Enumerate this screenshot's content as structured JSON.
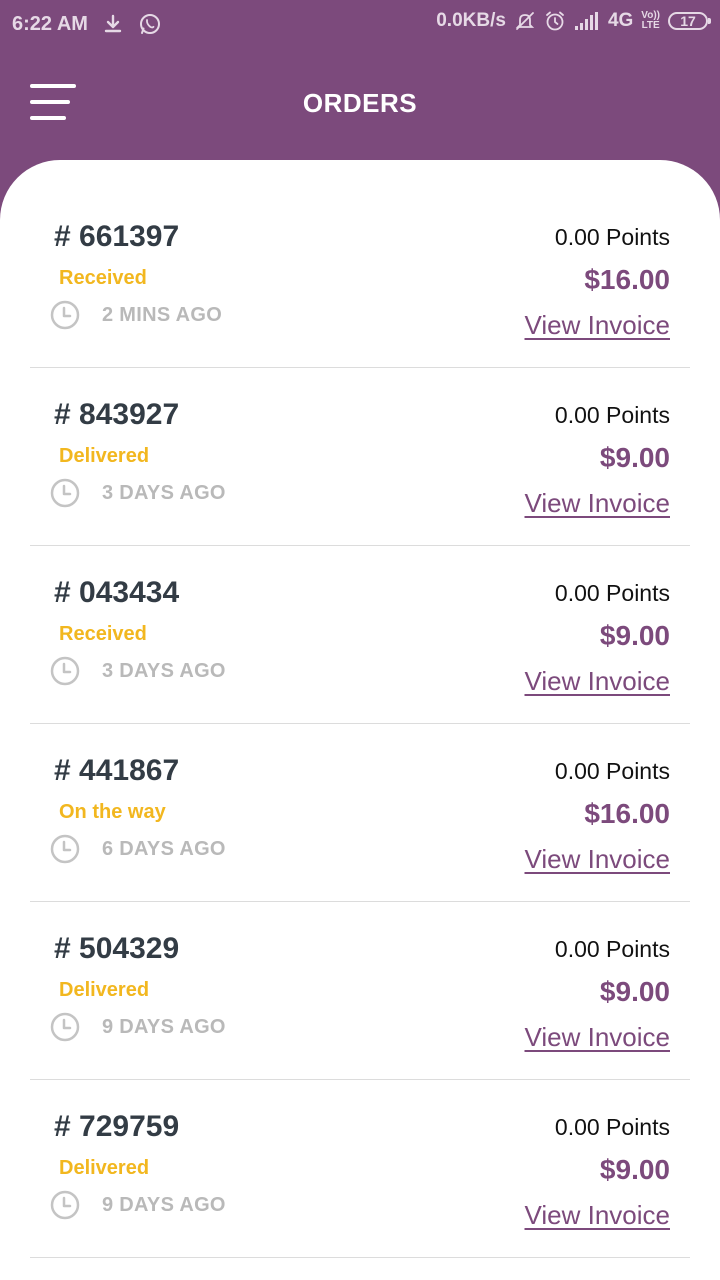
{
  "status_bar": {
    "time": "6:22 AM",
    "net_speed": "0.0KB/s",
    "network": "4G",
    "volte_top": "Vo))",
    "volte_bottom": "LTE",
    "battery": "17",
    "icons": [
      "download-icon",
      "whatsapp-icon",
      "mute-icon",
      "alarm-icon",
      "signal-icon"
    ]
  },
  "header": {
    "title": "ORDERS",
    "menu_icon": "hamburger-menu-icon"
  },
  "colors": {
    "brand": "#7c4a7c",
    "status": "#f2b71f",
    "order_id": "#333c45",
    "muted": "#b9b9b9"
  },
  "orders": [
    {
      "id": "# 661397",
      "status": "Received",
      "time": "2 MINS AGO",
      "points": "0.00 Points",
      "amount": "$16.00",
      "invoice_label": "View Invoice"
    },
    {
      "id": "# 843927",
      "status": "Delivered",
      "time": "3 DAYS AGO",
      "points": "0.00 Points",
      "amount": "$9.00",
      "invoice_label": "View Invoice"
    },
    {
      "id": "# 043434",
      "status": "Received",
      "time": "3 DAYS AGO",
      "points": "0.00 Points",
      "amount": "$9.00",
      "invoice_label": "View Invoice"
    },
    {
      "id": "# 441867",
      "status": "On the way",
      "time": "6 DAYS AGO",
      "points": "0.00 Points",
      "amount": "$16.00",
      "invoice_label": "View Invoice"
    },
    {
      "id": "# 504329",
      "status": "Delivered",
      "time": "9 DAYS AGO",
      "points": "0.00 Points",
      "amount": "$9.00",
      "invoice_label": "View Invoice"
    },
    {
      "id": "# 729759",
      "status": "Delivered",
      "time": "9 DAYS AGO",
      "points": "0.00 Points",
      "amount": "$9.00",
      "invoice_label": "View Invoice"
    }
  ]
}
